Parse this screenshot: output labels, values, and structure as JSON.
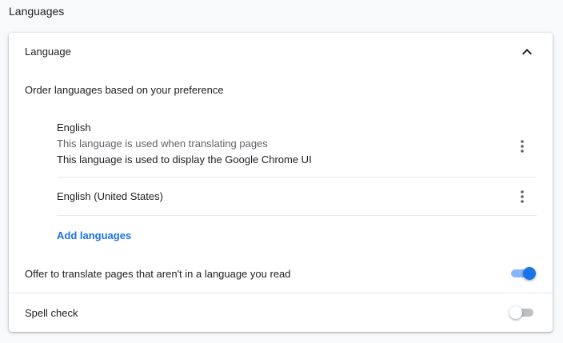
{
  "section": {
    "title": "Languages"
  },
  "card": {
    "header_label": "Language",
    "header_icon": "chevron-up-icon",
    "order_text": "Order languages based on your preference",
    "languages": [
      {
        "name": "English",
        "notes": [
          "This language is used when translating pages",
          "This language is used to display the Google Chrome UI"
        ],
        "menu_icon": "more-vert-icon"
      },
      {
        "name": "English (United States)",
        "notes": [],
        "menu_icon": "more-vert-icon"
      }
    ],
    "add_languages_label": "Add languages",
    "translate_offer": {
      "label": "Offer to translate pages that aren't in a language you read",
      "enabled": true
    },
    "spell_check": {
      "label": "Spell check",
      "enabled": false
    }
  },
  "colors": {
    "accent": "#1a73e8",
    "accent_track": "#8ab4f8",
    "secondary_text": "#5f6368",
    "divider": "#e8eaed",
    "background": "#f8f9fa"
  }
}
